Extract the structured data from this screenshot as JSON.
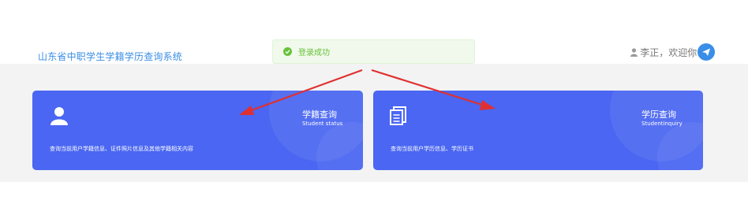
{
  "header": {
    "title": "山东省中职学生学籍学历查询系统",
    "user_greeting": "李正，欢迎你!"
  },
  "toast": {
    "message": "登录成功"
  },
  "cards": [
    {
      "title": "学籍查询",
      "subtitle": "Student status",
      "description": "查询当前用户学籍信息、证件照片信息及其他学籍相关内容"
    },
    {
      "title": "学历查询",
      "subtitle": "Studentinquiry",
      "description": "查询当前用户学历信息、学历证书"
    }
  ],
  "colors": {
    "card": "#4a66f2",
    "accent": "#3a8ee6",
    "success": "#67c23a",
    "arrow": "#e03030"
  },
  "icons": {
    "user_icon": "person-icon",
    "send_icon": "send-icon",
    "card1_icon": "user-icon",
    "card2_icon": "document-copy-icon"
  }
}
